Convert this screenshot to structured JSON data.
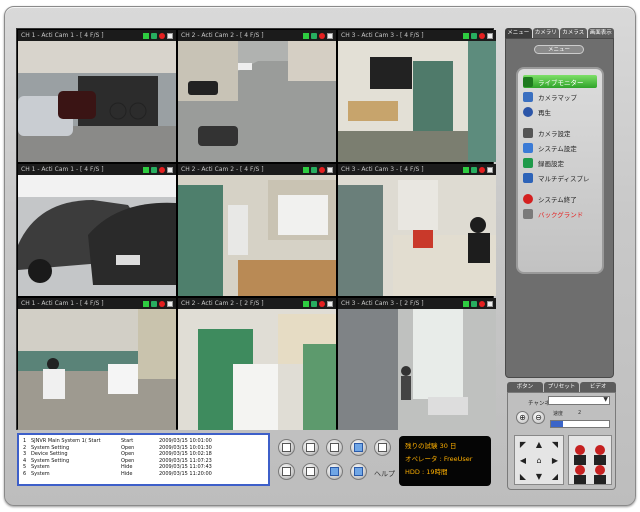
{
  "cameras": [
    {
      "title": "CH 1 - Acti Cam 1 - [ 4 F/S ]"
    },
    {
      "title": "CH 2 - Acti Cam 2 - [ 4 F/S ]"
    },
    {
      "title": "CH 3 - Acti Cam 3 - [ 4 F/S ]"
    },
    {
      "title": "CH 1 - Acti Cam 1 - [ 4 F/S ]"
    },
    {
      "title": "CH 2 - Acti Cam 2 - [ 4 F/S ]"
    },
    {
      "title": "CH 3 - Acti Cam 3 - [ 4 F/S ]"
    },
    {
      "title": "CH 1 - Acti Cam 1 - [ 4 F/S ]"
    },
    {
      "title": "CH 2 - Acti Cam 2 - [ 2 F/S ]"
    },
    {
      "title": "CH 3 - Acti Cam 3 - [ 2 F/S ]"
    }
  ],
  "log": {
    "rows": [
      {
        "no": "1",
        "event": "SJNVR Main System 1( Start",
        "state": "Start",
        "time": "2009/03/15 10:01:00"
      },
      {
        "no": "2",
        "event": "System Setting",
        "state": "Open",
        "time": "2009/03/15 10:01:30"
      },
      {
        "no": "3",
        "event": "Device Setting",
        "state": "Open",
        "time": "2009/03/15 10:02:18"
      },
      {
        "no": "4",
        "event": "System Setting",
        "state": "Open",
        "time": "2009/03/15 11:07:23"
      },
      {
        "no": "5",
        "event": "System",
        "state": "Hide",
        "time": "2009/03/15 11:07:43"
      },
      {
        "no": "6",
        "event": "System",
        "state": "Hide",
        "time": "2009/03/15 11:20:00"
      }
    ]
  },
  "layout_buttons": {
    "help_label": "ヘルプ"
  },
  "status": {
    "trial": "残りの試験 30 日",
    "operator": "オペレータ : FreeUser",
    "hdd": "HDD : 19時間"
  },
  "right_panel": {
    "tabs": [
      "メニュー",
      "カメラリ",
      "カメラス",
      "画面表示"
    ],
    "menu_header": "メニュー",
    "items": [
      {
        "label": "ライブモニター",
        "active": true
      },
      {
        "label": "カメラマップ"
      },
      {
        "label": "再生"
      },
      {
        "label": "カメラ設定"
      },
      {
        "label": "システム設定"
      },
      {
        "label": "録画設定"
      },
      {
        "label": "マルチディスプレ"
      },
      {
        "label": "システム終了"
      },
      {
        "label": "バックグランド",
        "red": true
      }
    ]
  },
  "ptz": {
    "tabs": [
      "ボタン",
      "プリセット",
      "ビデオ"
    ],
    "channel_label": "チャンネル",
    "speed_label": "速度",
    "speed_value": "2"
  },
  "colors": {
    "accent_blue": "#3d5fc9",
    "status_amber": "#ffb000",
    "active_green": "#2fa32a"
  }
}
